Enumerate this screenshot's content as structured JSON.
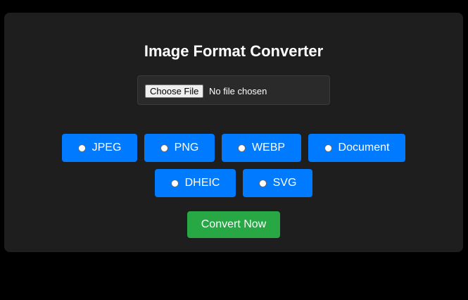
{
  "title": "Image Format Converter",
  "file_input": {
    "button_label": "Choose File",
    "status": "No file chosen"
  },
  "formats": [
    {
      "label": "JPEG",
      "selected": false
    },
    {
      "label": "PNG",
      "selected": false
    },
    {
      "label": "WEBP",
      "selected": false
    },
    {
      "label": "Document",
      "selected": false
    },
    {
      "label": "DHEIC",
      "selected": false
    },
    {
      "label": "SVG",
      "selected": false
    }
  ],
  "convert_button": {
    "label": "Convert Now"
  },
  "colors": {
    "page_background": "#000000",
    "card_background": "#1e1e1e",
    "format_button": "#007bff",
    "convert_button": "#28a745",
    "text": "#ffffff"
  }
}
